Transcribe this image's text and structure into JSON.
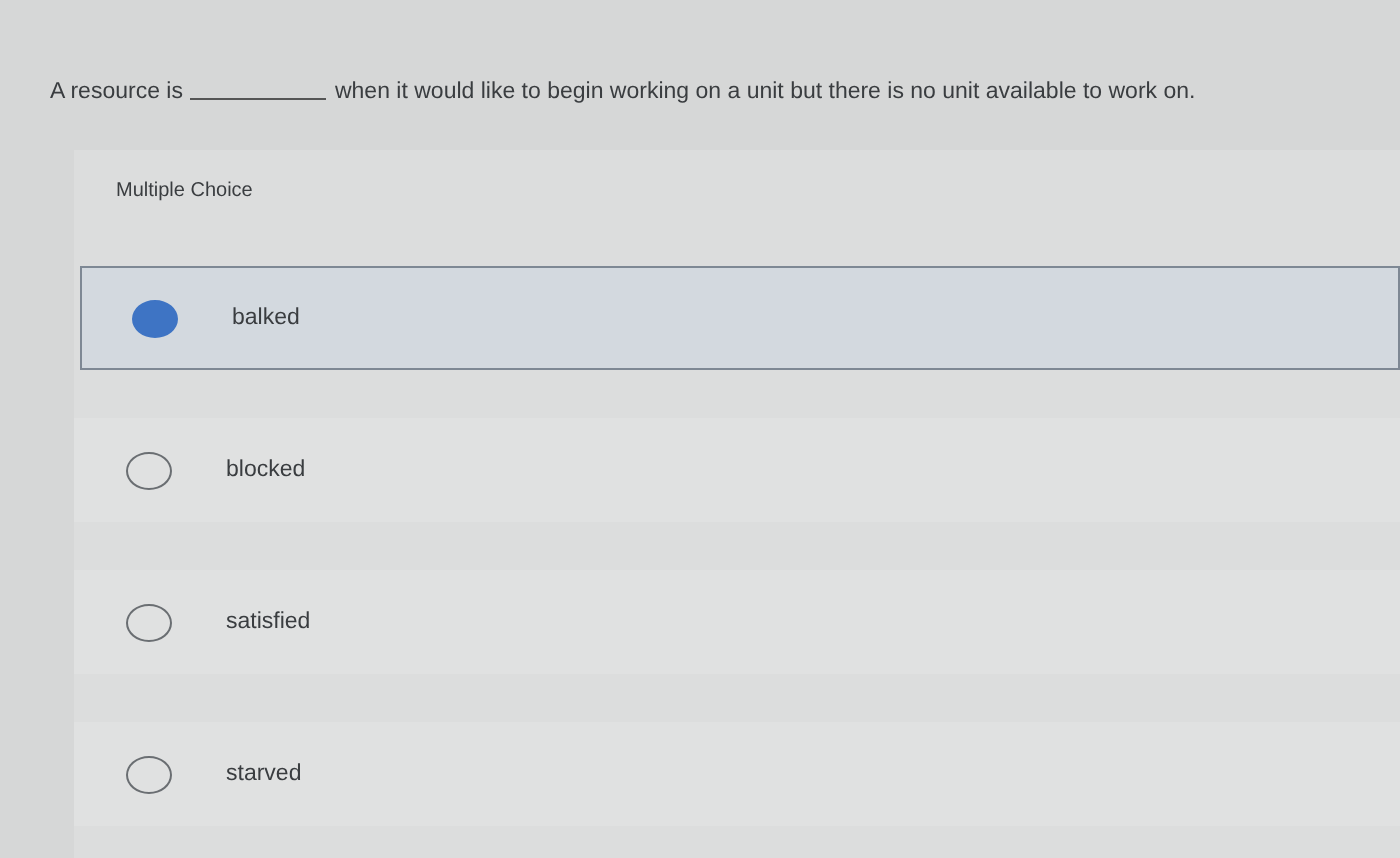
{
  "question": {
    "before": "A resource is",
    "after": "when it would like to begin working on a unit but there is no unit available to work on."
  },
  "question_type": "Multiple Choice",
  "options": [
    {
      "label": "balked",
      "selected": true
    },
    {
      "label": "blocked",
      "selected": false
    },
    {
      "label": "satisfied",
      "selected": false
    },
    {
      "label": "starved",
      "selected": false
    }
  ]
}
